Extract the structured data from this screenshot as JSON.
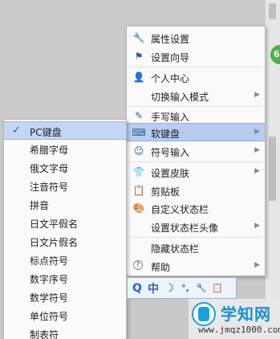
{
  "main_menu": {
    "items": [
      {
        "label": "属性设置",
        "icon": "wrench-icon",
        "glyph": "🔧",
        "has_submenu": false
      },
      {
        "label": "设置向导",
        "icon": "flag-icon",
        "glyph": "⚑",
        "has_submenu": false
      },
      {
        "label": "个人中心",
        "icon": "person-icon",
        "glyph": "👤",
        "has_submenu": false
      },
      {
        "label": "切换输入模式",
        "icon": "",
        "glyph": "",
        "has_submenu": true
      },
      {
        "label": "手写输入",
        "icon": "pen-icon",
        "glyph": "✎",
        "has_submenu": false
      },
      {
        "label": "软键盘",
        "icon": "keyboard-icon",
        "glyph": "⌨",
        "has_submenu": true
      },
      {
        "label": "符号输入",
        "icon": "smiley-icon",
        "glyph": "☺",
        "has_submenu": true
      },
      {
        "label": "设置皮肤",
        "icon": "shirt-icon",
        "glyph": "👕",
        "has_submenu": true
      },
      {
        "label": "剪贴板",
        "icon": "clipboard-icon",
        "glyph": "📋",
        "has_submenu": false
      },
      {
        "label": "自定义状态栏",
        "icon": "palette-icon",
        "glyph": "🎨",
        "has_submenu": false
      },
      {
        "label": "设置状态栏头像",
        "icon": "",
        "glyph": "",
        "has_submenu": true
      },
      {
        "label": "隐藏状态栏",
        "icon": "",
        "glyph": "",
        "has_submenu": false
      },
      {
        "label": "帮助",
        "icon": "help-icon",
        "glyph": "?",
        "has_submenu": true
      }
    ],
    "arrow": "▶"
  },
  "sub_menu": {
    "check": "✓",
    "items": [
      {
        "label": "PC键盘",
        "checked": true
      },
      {
        "label": "希腊字母",
        "checked": false
      },
      {
        "label": "俄文字母",
        "checked": false
      },
      {
        "label": "注音符号",
        "checked": false
      },
      {
        "label": "拼音",
        "checked": false
      },
      {
        "label": "日文平假名",
        "checked": false
      },
      {
        "label": "日文片假名",
        "checked": false
      },
      {
        "label": "标点符号",
        "checked": false
      },
      {
        "label": "数字序号",
        "checked": false
      },
      {
        "label": "数学符号",
        "checked": false
      },
      {
        "label": "单位符号",
        "checked": false
      },
      {
        "label": "制表符",
        "checked": false
      }
    ]
  },
  "toolbar": {
    "search": "Q",
    "chinese": "中",
    "moon": "☽",
    "punct": "°,",
    "wrench": "🔧",
    "clip": "📋"
  },
  "watermark": {
    "title": "学知网",
    "url": "www.jmqz1000.com"
  },
  "badge": "6",
  "colors": {
    "accent": "#1f66c7",
    "active": "#b7cdf0",
    "watermark": "#1a8fd4"
  }
}
